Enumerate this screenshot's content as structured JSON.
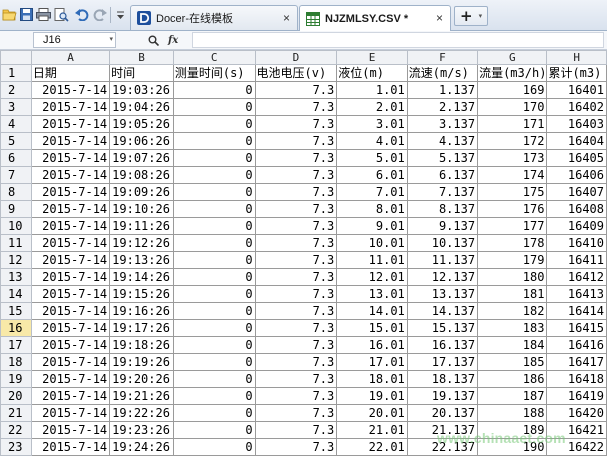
{
  "toolbar": {
    "icons": [
      "folder-open-icon",
      "save-icon",
      "print-icon",
      "print-preview-icon",
      "undo-icon",
      "redo-icon",
      "customize-dropdown-icon"
    ]
  },
  "tabs": [
    {
      "label": "Docer-在线模板",
      "icon": "docer-icon",
      "active": false
    },
    {
      "label": "NJZMLSY.CSV *",
      "icon": "spreadsheet-icon",
      "active": true
    }
  ],
  "tab_close_glyph": "×",
  "new_tab": {
    "plus": "+",
    "drop": "▾"
  },
  "name_box": {
    "value": "J16",
    "drop": "▾"
  },
  "formula_bar": {
    "zoom_icon": "zoom-icon",
    "fx_label": "fx",
    "value": ""
  },
  "columns": [
    "A",
    "B",
    "C",
    "D",
    "E",
    "F",
    "G",
    "H"
  ],
  "header_row": [
    "日期",
    "时间",
    "测量时间(s)",
    "电池电压(v)",
    "液位(m)",
    "流速(m/s)",
    "流量(m3/h)",
    "累计(m3)"
  ],
  "rows": [
    [
      "2015-7-14",
      "19:03:26",
      "0",
      "7.3",
      "1.01",
      "1.137",
      "169",
      "16401"
    ],
    [
      "2015-7-14",
      "19:04:26",
      "0",
      "7.3",
      "2.01",
      "2.137",
      "170",
      "16402"
    ],
    [
      "2015-7-14",
      "19:05:26",
      "0",
      "7.3",
      "3.01",
      "3.137",
      "171",
      "16403"
    ],
    [
      "2015-7-14",
      "19:06:26",
      "0",
      "7.3",
      "4.01",
      "4.137",
      "172",
      "16404"
    ],
    [
      "2015-7-14",
      "19:07:26",
      "0",
      "7.3",
      "5.01",
      "5.137",
      "173",
      "16405"
    ],
    [
      "2015-7-14",
      "19:08:26",
      "0",
      "7.3",
      "6.01",
      "6.137",
      "174",
      "16406"
    ],
    [
      "2015-7-14",
      "19:09:26",
      "0",
      "7.3",
      "7.01",
      "7.137",
      "175",
      "16407"
    ],
    [
      "2015-7-14",
      "19:10:26",
      "0",
      "7.3",
      "8.01",
      "8.137",
      "176",
      "16408"
    ],
    [
      "2015-7-14",
      "19:11:26",
      "0",
      "7.3",
      "9.01",
      "9.137",
      "177",
      "16409"
    ],
    [
      "2015-7-14",
      "19:12:26",
      "0",
      "7.3",
      "10.01",
      "10.137",
      "178",
      "16410"
    ],
    [
      "2015-7-14",
      "19:13:26",
      "0",
      "7.3",
      "11.01",
      "11.137",
      "179",
      "16411"
    ],
    [
      "2015-7-14",
      "19:14:26",
      "0",
      "7.3",
      "12.01",
      "12.137",
      "180",
      "16412"
    ],
    [
      "2015-7-14",
      "19:15:26",
      "0",
      "7.3",
      "13.01",
      "13.137",
      "181",
      "16413"
    ],
    [
      "2015-7-14",
      "19:16:26",
      "0",
      "7.3",
      "14.01",
      "14.137",
      "182",
      "16414"
    ],
    [
      "2015-7-14",
      "19:17:26",
      "0",
      "7.3",
      "15.01",
      "15.137",
      "183",
      "16415"
    ],
    [
      "2015-7-14",
      "19:18:26",
      "0",
      "7.3",
      "16.01",
      "16.137",
      "184",
      "16416"
    ],
    [
      "2015-7-14",
      "19:19:26",
      "0",
      "7.3",
      "17.01",
      "17.137",
      "185",
      "16417"
    ],
    [
      "2015-7-14",
      "19:20:26",
      "0",
      "7.3",
      "18.01",
      "18.137",
      "186",
      "16418"
    ],
    [
      "2015-7-14",
      "19:21:26",
      "0",
      "7.3",
      "19.01",
      "19.137",
      "187",
      "16419"
    ],
    [
      "2015-7-14",
      "19:22:26",
      "0",
      "7.3",
      "20.01",
      "20.137",
      "188",
      "16420"
    ],
    [
      "2015-7-14",
      "19:23:26",
      "0",
      "7.3",
      "21.01",
      "21.137",
      "189",
      "16421"
    ],
    [
      "2015-7-14",
      "19:24:26",
      "0",
      "7.3",
      "22.01",
      "22.137",
      "190",
      "16422"
    ]
  ],
  "selected_row": "16",
  "selected_column": "J",
  "watermark": "www.chinaaet.com",
  "colors": {
    "selected_row_header": "#f8e9a8",
    "header_bg": "#f0f2f5",
    "grid_line": "#9a9a9a",
    "watermark": "#78c878"
  }
}
